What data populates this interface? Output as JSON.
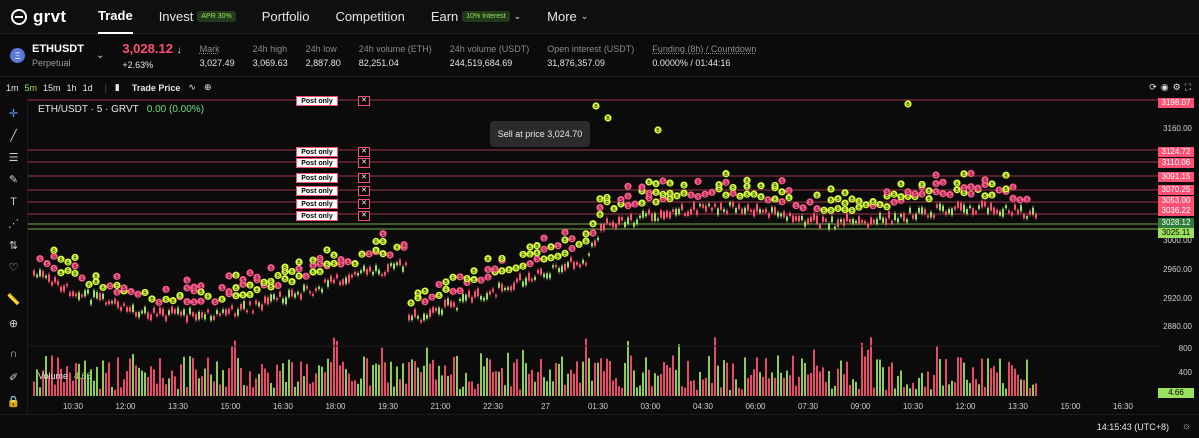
{
  "nav": {
    "logo": "grvt",
    "items": [
      {
        "label": "Trade",
        "active": true
      },
      {
        "label": "Invest",
        "badge": "APR 30%"
      },
      {
        "label": "Portfolio"
      },
      {
        "label": "Competition"
      },
      {
        "label": "Earn",
        "badge": "10% Interest",
        "dropdown": true
      },
      {
        "label": "More",
        "dropdown": true
      }
    ]
  },
  "ticker": {
    "symbol": "ETHUSDT",
    "type": "Perpetual",
    "price": "3,028.12",
    "arrow": "↓",
    "change": "+2.63%",
    "stats": [
      {
        "label": "Mark",
        "value": "3,027.49"
      },
      {
        "label": "24h high",
        "value": "3,069.63"
      },
      {
        "label": "24h low",
        "value": "2,887.80"
      },
      {
        "label": "24h volume (ETH)",
        "value": "82,251.04"
      },
      {
        "label": "24h volume (USDT)",
        "value": "244,519,684.69"
      },
      {
        "label": "Open interest (USDT)",
        "value": "31,876,357.09"
      },
      {
        "label": "Funding (8h) / Countdown",
        "value": "0.0000% / 01:44:16"
      }
    ]
  },
  "toolbar": {
    "timeframes": [
      "1m",
      "5m",
      "15m",
      "1h",
      "1d"
    ],
    "active_timeframe": "5m",
    "trade_price": "Trade Price"
  },
  "chart": {
    "title": "ETH/USDT · 5 · GRVT",
    "change": "0.00 (0.00%)",
    "tooltip": "Sell at price 3,024.70",
    "volume_label": "Volume",
    "volume_value": "4.66",
    "order_label": "Post only",
    "price_ticks": [
      "3160.00",
      "3000.00",
      "2960.00",
      "2920.00",
      "2880.00"
    ],
    "price_tags": [
      {
        "v": "3198.07",
        "c": "#ff5073"
      },
      {
        "v": "3124.72",
        "c": "#ff5073"
      },
      {
        "v": "3110.06",
        "c": "#ff5073"
      },
      {
        "v": "3091.15",
        "c": "#ff5073"
      },
      {
        "v": "3070.25",
        "c": "#ff5073"
      },
      {
        "v": "3053.00",
        "c": "#ff5073"
      },
      {
        "v": "3036.22",
        "c": "#ff5073"
      },
      {
        "v": "3028.12",
        "c": "#2e7d3a"
      },
      {
        "v": "3025.11",
        "c": "#9be15d"
      }
    ],
    "volume_ticks": [
      "800",
      "400",
      "4.66"
    ],
    "time_ticks": [
      "10:30",
      "12:00",
      "13:30",
      "15:00",
      "16:30",
      "18:00",
      "19:30",
      "21:00",
      "22:30",
      "27",
      "01:30",
      "03:00",
      "04:30",
      "06:00",
      "07:30",
      "09:00",
      "10:30",
      "12:00",
      "13:30",
      "15:00",
      "16:30"
    ],
    "clock": "14:15:43 (UTC+8)"
  },
  "colors": {
    "up": "#9be15d",
    "down": "#ff5073",
    "background": "#0b0b0c"
  }
}
